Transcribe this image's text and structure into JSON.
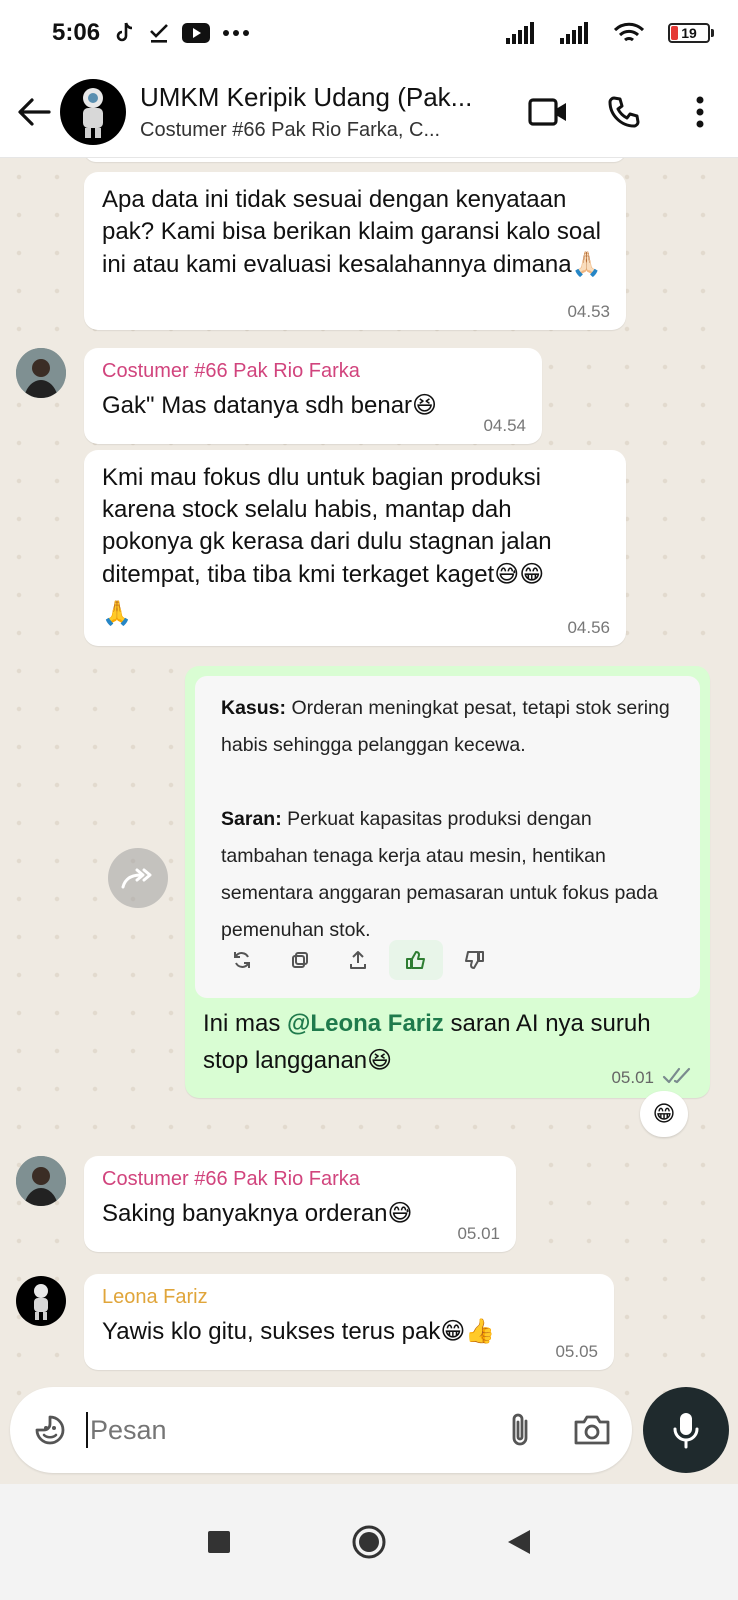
{
  "status_bar": {
    "time": "5:06",
    "battery": "19",
    "battery_level": 0.19,
    "icons": [
      "tiktok-icon",
      "download-done-icon",
      "youtube-icon",
      "more-dots-icon",
      "signal-icon",
      "signal-icon",
      "wifi-icon",
      "battery-icon"
    ]
  },
  "header": {
    "title": "UMKM Keripik Udang (Pak...",
    "subtitle": "Costumer #66 Pak Rio Farka, C...",
    "icons": [
      "back-arrow-icon",
      "video-call-icon",
      "phone-icon",
      "more-vertical-icon"
    ]
  },
  "messages": {
    "m1": {
      "text": "Apa data ini tidak sesuai dengan kenyataan pak? Kami bisa berikan klaim garansi kalo soal ini atau kami evaluasi kesalahannya dimana",
      "emoji": "🙏🏻",
      "time": "04.53"
    },
    "m2": {
      "sender": "Costumer #66 Pak Rio Farka",
      "text": "Gak\" Mas datanya sdh benar",
      "emoji": "😆",
      "time": "04.54"
    },
    "m3": {
      "text": "Kmi mau fokus dlu untuk bagian produksi karena stock selalu habis, mantap dah pokonya gk kerasa dari dulu stagnan jalan ditempat, tiba tiba kmi terkaget kaget",
      "emoji": "😅😁",
      "emoji2": "🙏",
      "time": "04.56"
    },
    "m4": {
      "quote": {
        "kasus_label": "Kasus:",
        "kasus_text": " Orderan meningkat pesat, tetapi stok sering habis sehingga pelanggan kecewa.",
        "saran_label": "Saran:",
        "saran_text": " Perkuat kapasitas produksi dengan tambahan tenaga kerja atau mesin, hentikan sementara anggaran pemasaran untuk fokus pada pemenuhan stok.",
        "actions": [
          "regenerate-icon",
          "copy-icon",
          "share-icon",
          "thumbs-up-icon",
          "thumbs-down-icon"
        ]
      },
      "text_before": "Ini mas ",
      "mention": "@Leona Fariz",
      "text_after": " saran AI nya suruh stop langganan",
      "emoji": "😆",
      "time": "05.01",
      "reaction": "😁"
    },
    "m5": {
      "sender": "Costumer #66 Pak Rio Farka",
      "text": "Saking banyaknya orderan",
      "emoji": "😅",
      "time": "05.01"
    },
    "m6": {
      "sender": "Leona Fariz",
      "text": "Yawis klo gitu, sukses terus pak",
      "emoji": "😁👍",
      "time": "05.05"
    }
  },
  "input": {
    "placeholder": "Pesan",
    "icons": [
      "sticker-icon",
      "attach-icon",
      "camera-icon",
      "mic-icon"
    ]
  },
  "nav": {
    "icons": [
      "recents-square-icon",
      "home-circle-icon",
      "back-triangle-icon"
    ]
  },
  "colors": {
    "outgoing_bubble": "#d9fdd3",
    "incoming_bubble": "#ffffff",
    "chat_background": "#efeae2",
    "sender_pink": "#d1447d",
    "sender_gold": "#e0a53a",
    "mention_green": "#1f7a4c",
    "mic_button": "#1f2a2d"
  }
}
